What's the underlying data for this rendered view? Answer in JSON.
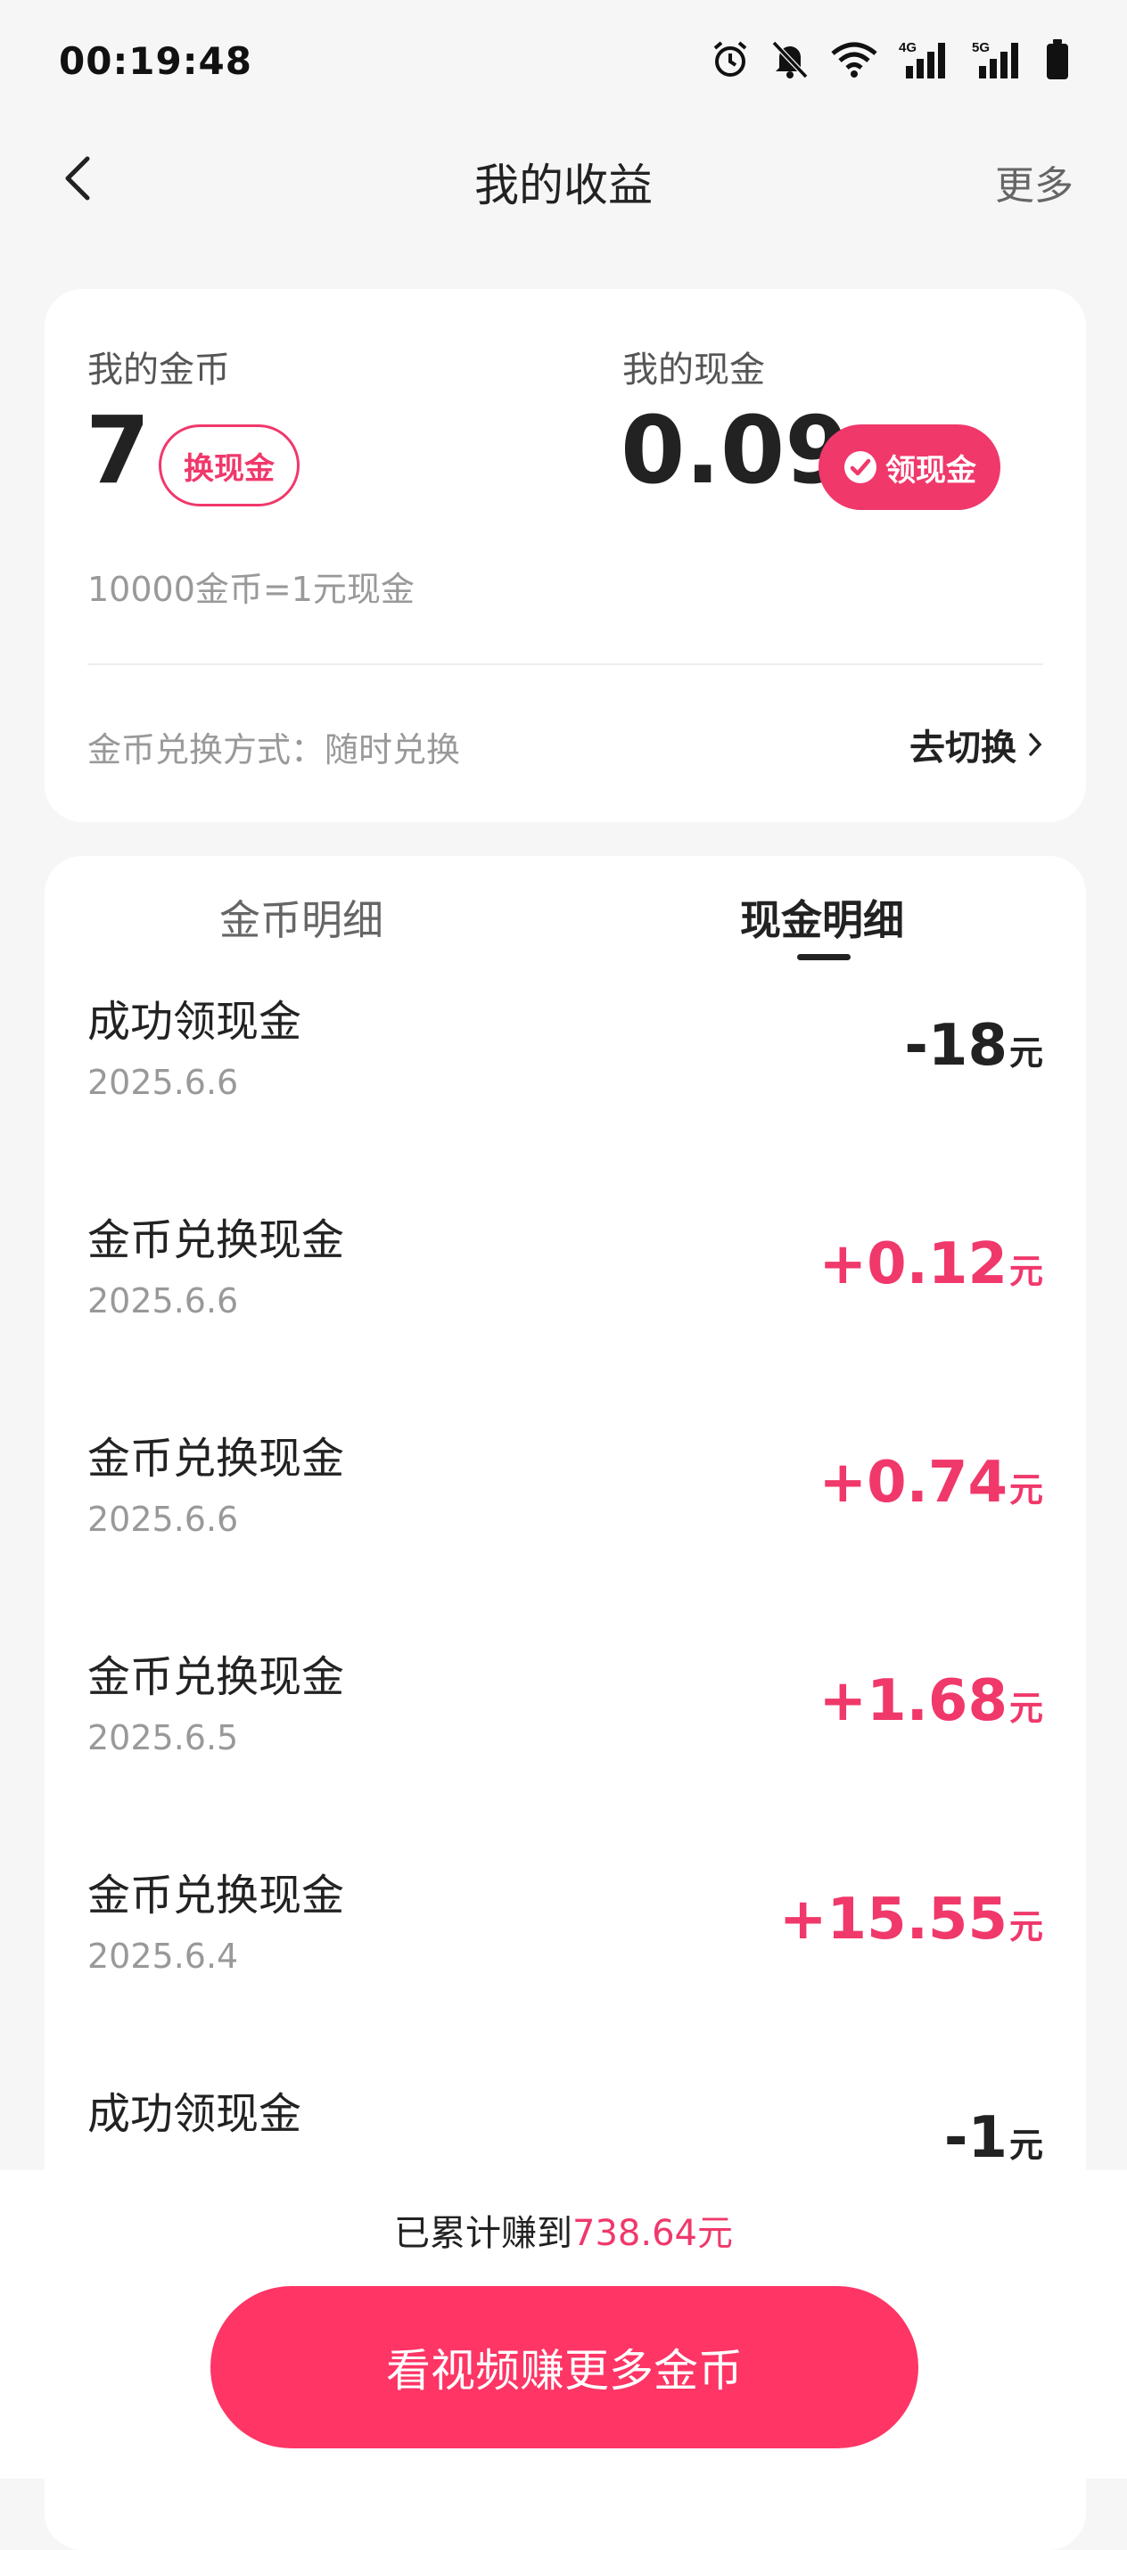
{
  "status_bar": {
    "time": "00:19:48",
    "icons": [
      "alarm-icon",
      "mute-bell-icon",
      "wifi-icon",
      "signal-4g-icon",
      "signal-5g-icon",
      "battery-icon"
    ],
    "labels": {
      "net1": "4G",
      "net2": "5G"
    }
  },
  "header": {
    "title": "我的收益",
    "more_label": "更多",
    "back_icon": "back-arrow-icon"
  },
  "balance": {
    "coin_label": "我的金币",
    "coin_value": "7",
    "exchange_button": "换现金",
    "cash_label": "我的现金",
    "cash_value": "0.09",
    "withdraw_button": "领现金",
    "rate_text": "10000金币=1元现金",
    "method_text": "金币兑换方式：随时兑换",
    "switch_label": "去切换"
  },
  "tabs": [
    {
      "label": "金币明细",
      "active": false
    },
    {
      "label": "现金明细",
      "active": true
    }
  ],
  "transactions": [
    {
      "title": "成功领现金",
      "date": "2025.6.6",
      "amount": "-18",
      "unit": "元",
      "type": "debit"
    },
    {
      "title": "金币兑换现金",
      "date": "2025.6.6",
      "amount": "+0.12",
      "unit": "元",
      "type": "credit"
    },
    {
      "title": "金币兑换现金",
      "date": "2025.6.6",
      "amount": "+0.74",
      "unit": "元",
      "type": "credit"
    },
    {
      "title": "金币兑换现金",
      "date": "2025.6.5",
      "amount": "+1.68",
      "unit": "元",
      "type": "credit"
    },
    {
      "title": "金币兑换现金",
      "date": "2025.6.4",
      "amount": "+15.55",
      "unit": "元",
      "type": "credit"
    },
    {
      "title": "成功领现金",
      "date": "",
      "amount": "-1",
      "unit": "元",
      "type": "debit"
    }
  ],
  "footer": {
    "total_prefix": "已累计赚到",
    "total_value": "738.64元",
    "cta_label": "看视频赚更多金币"
  },
  "colors": {
    "accent": "#f0386b",
    "cta": "#fe3565",
    "debit": "#222222",
    "credit": "#f0386b"
  }
}
